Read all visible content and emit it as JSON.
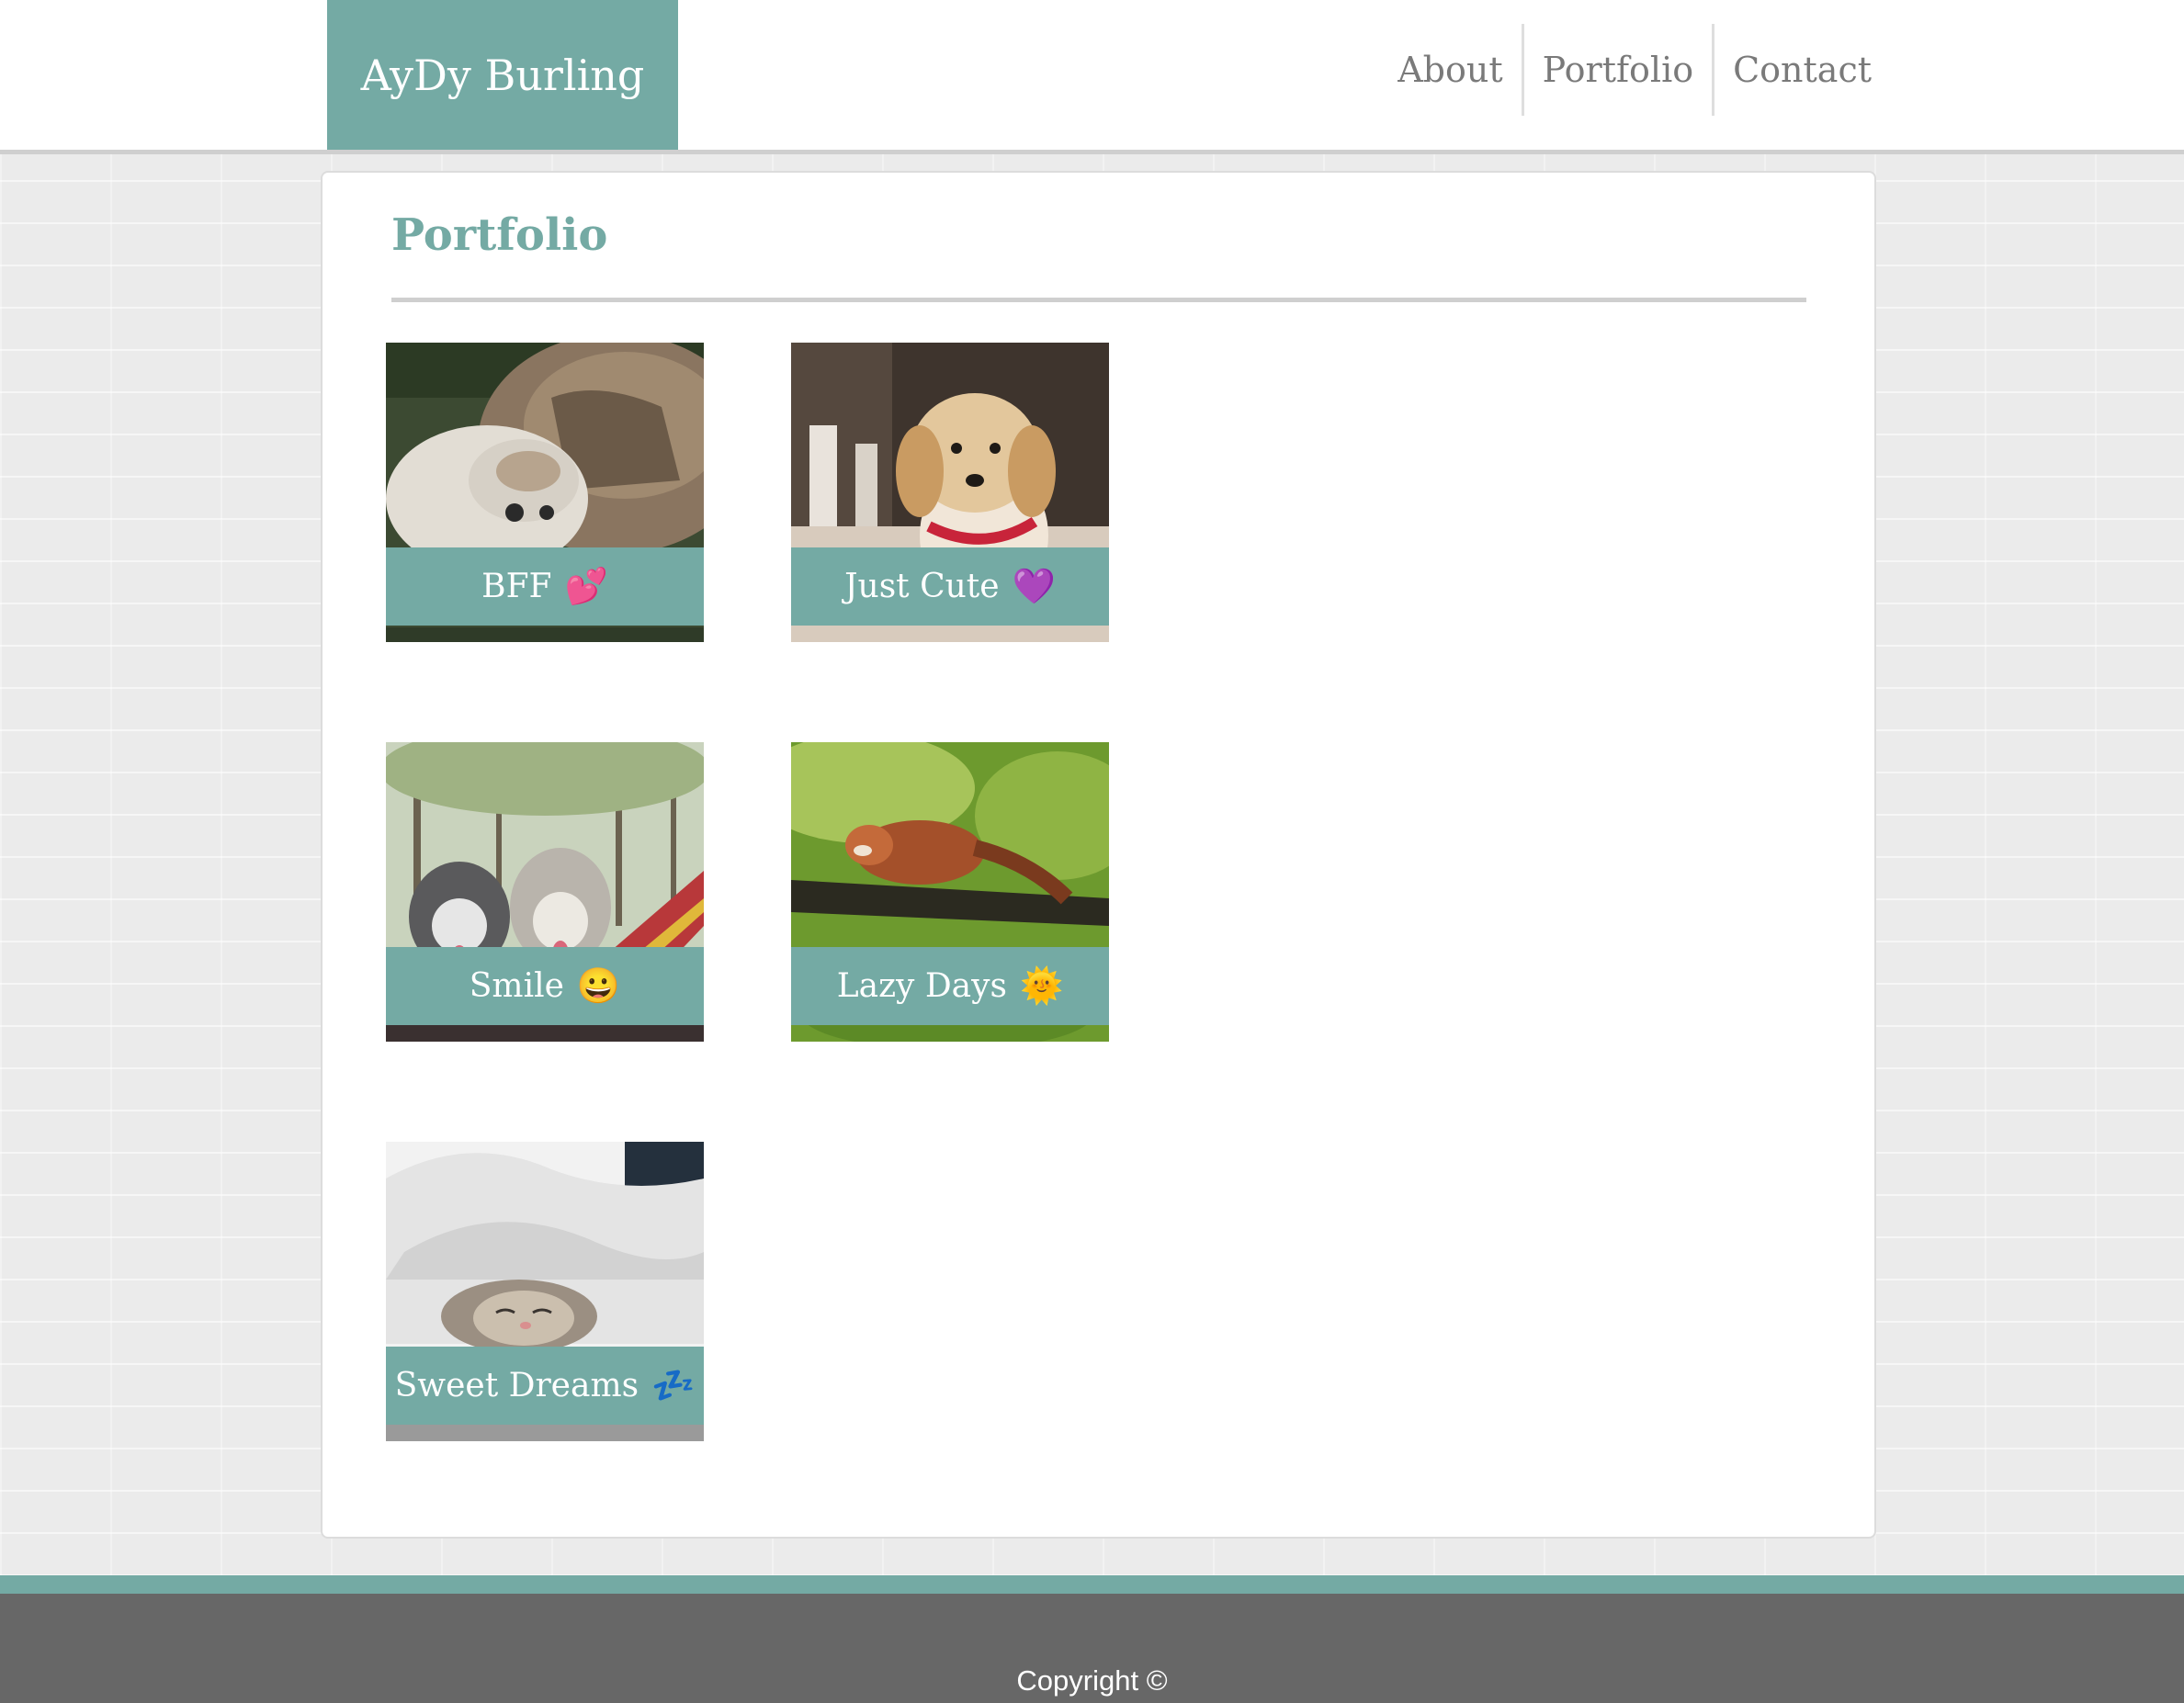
{
  "header": {
    "brand": "AyDy Burling",
    "nav": [
      {
        "label": "About"
      },
      {
        "label": "Portfolio"
      },
      {
        "label": "Contact"
      }
    ]
  },
  "main": {
    "title": "Portfolio",
    "cards": [
      {
        "caption": "BFF",
        "emoji": "💕"
      },
      {
        "caption": "Just Cute",
        "emoji": "💜"
      },
      {
        "caption": "Smile",
        "emoji": "😀"
      },
      {
        "caption": "Lazy Days",
        "emoji": "🌞"
      },
      {
        "caption": "Sweet Dreams",
        "emoji": "💤"
      }
    ]
  },
  "footer": {
    "copyright": "Copyright ©"
  },
  "colors": {
    "accent": "#74aaa4",
    "footer": "#676767",
    "nav_text": "#7a7a7a"
  }
}
